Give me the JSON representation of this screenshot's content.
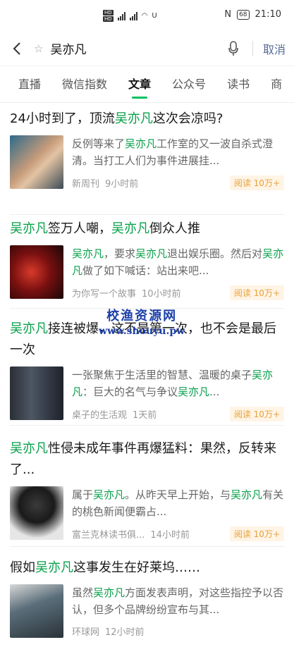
{
  "status": {
    "time": "21:10",
    "battery": "68"
  },
  "search": {
    "query": "吴亦凡",
    "cancel": "取消"
  },
  "tabs": [
    {
      "label": "直播"
    },
    {
      "label": "微信指数"
    },
    {
      "label": "文章"
    },
    {
      "label": "公众号"
    },
    {
      "label": "读书"
    },
    {
      "label": "商"
    }
  ],
  "articles": [
    {
      "title": [
        "24小时到了，顶流",
        "吴亦凡",
        "这次会凉吗?"
      ],
      "desc": [
        "反例等来了",
        "吴亦凡",
        "工作室的又一波自杀式澄清。当打工人们为事件进展挂..."
      ],
      "source": "新周刊",
      "time": "9小时前",
      "reads": "阅读 10万+"
    },
    {
      "title": [
        "吴亦凡",
        "签万人嘲，",
        "吴亦凡",
        "倒众人推"
      ],
      "desc": [
        "吴亦凡",
        "，要求",
        "吴亦凡",
        "退出娱乐圈。然后对",
        "吴亦凡",
        "做了如下喊话：站出来吧..."
      ],
      "source": "为你写一个故事",
      "time": "10小时前",
      "reads": "阅读 10万+"
    },
    {
      "title": [
        "吴亦凡",
        "接连被爆，这不是第一次，也不会是最后一次"
      ],
      "desc": [
        "一张聚焦于生活里的智慧、温暖的桌子",
        "吴亦凡",
        "：巨大的名气与争议",
        "吴亦凡",
        "..."
      ],
      "source": "桌子的生活观",
      "time": "1天前",
      "reads": "阅读 10万+"
    },
    {
      "title": [
        "吴亦凡",
        "性侵未成年事件再爆猛料：果然，反转来了..."
      ],
      "desc": [
        "属于",
        "吴亦凡",
        "。从昨天早上开始，与",
        "吴亦凡",
        "有关的桃色新闻便霸占..."
      ],
      "source": "富兰克林读书俱...",
      "time": "14小时前",
      "reads": "阅读 10万+"
    },
    {
      "title": [
        "假如",
        "吴亦凡",
        "这事发生在好莱坞……"
      ],
      "desc": [
        "虽然",
        "吴亦凡",
        "方面发表声明，对这些指控予以否认，但多个品牌纷纷宣布与其..."
      ],
      "source": "环球网",
      "time": "12小时前",
      "reads": ""
    }
  ],
  "watermark": {
    "line1": "校渔资源网",
    "line2": "www.shouyu.pw"
  },
  "colors": {
    "highlight": "#07a04a",
    "accent": "#07c160",
    "cancel": "#576b95",
    "reads_bg": "#fff4e5",
    "reads_fg": "#e8a13a"
  }
}
